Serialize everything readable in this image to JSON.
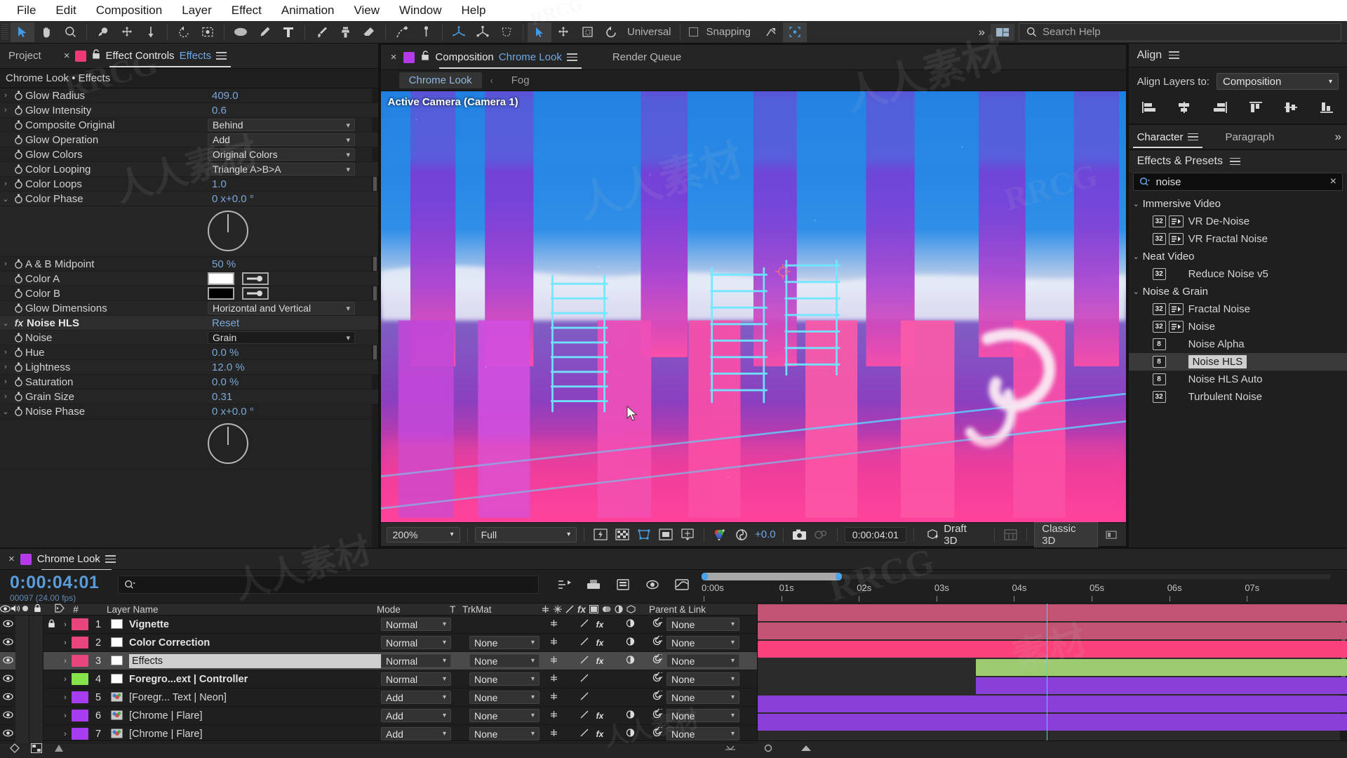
{
  "app": {
    "menu": [
      "File",
      "Edit",
      "Composition",
      "Layer",
      "Effect",
      "Animation",
      "View",
      "Window",
      "Help"
    ],
    "search_help_placeholder": "Search Help",
    "search_icon": "search-icon",
    "universal_label": "Universal",
    "snapping_label": "Snapping"
  },
  "effect_controls": {
    "tab_project": "Project",
    "tab_effect_controls": "Effect Controls",
    "tab_effect_target": "Effects",
    "breadcrumb": "Chrome Look • Effects",
    "rows": [
      {
        "name": "Glow Radius",
        "value": "409.0",
        "kind": "num",
        "twirl": true
      },
      {
        "name": "Glow Intensity",
        "value": "0.6",
        "kind": "num",
        "twirl": true
      },
      {
        "name": "Composite Original",
        "value": "Behind",
        "kind": "drop"
      },
      {
        "name": "Glow Operation",
        "value": "Add",
        "kind": "drop"
      },
      {
        "name": "Glow Colors",
        "value": "Original Colors",
        "kind": "drop"
      },
      {
        "name": "Color Looping",
        "value": "Triangle A>B>A",
        "kind": "drop"
      },
      {
        "name": "Color Loops",
        "value": "1.0",
        "kind": "num",
        "twirl": true
      },
      {
        "name": "Color Phase",
        "value": "0 x+0.0 °",
        "kind": "num",
        "twirl": "open"
      },
      {
        "name": "A & B Midpoint",
        "value": "50 %",
        "kind": "num",
        "twirl": true
      },
      {
        "name": "Color A",
        "value": "#ffffff",
        "kind": "color"
      },
      {
        "name": "Color B",
        "value": "#000000",
        "kind": "color"
      },
      {
        "name": "Glow Dimensions",
        "value": "Horizontal and Vertical",
        "kind": "drop"
      },
      {
        "name": "Noise HLS",
        "value": "Reset",
        "kind": "effect"
      },
      {
        "name": "Noise",
        "value": "Grain",
        "kind": "drop-dark"
      },
      {
        "name": "Hue",
        "value": "0.0 %",
        "kind": "num",
        "twirl": true
      },
      {
        "name": "Lightness",
        "value": "12.0 %",
        "kind": "num",
        "twirl": true
      },
      {
        "name": "Saturation",
        "value": "0.0 %",
        "kind": "num",
        "twirl": true
      },
      {
        "name": "Grain Size",
        "value": "0.31",
        "kind": "num",
        "twirl": true
      },
      {
        "name": "Noise Phase",
        "value": "0 x+0.0 °",
        "kind": "num",
        "twirl": "open"
      }
    ]
  },
  "composition": {
    "panel_label": "Composition",
    "comp_name": "Chrome Look",
    "render_queue": "Render Queue",
    "subtabs": [
      {
        "label": "Chrome Look",
        "active": true
      },
      {
        "label": "Fog",
        "active": false
      }
    ],
    "camera_label": "Active Camera (Camera 1)",
    "bottom": {
      "zoom": "200%",
      "resolution": "Full",
      "exposure": "+0.0",
      "timecode": "0:00:04:01",
      "draft3d": "Draft 3D",
      "renderer": "Classic 3D"
    }
  },
  "align_panel": {
    "title": "Align",
    "align_layers_to_label": "Align Layers to:",
    "align_layers_to_value": "Composition"
  },
  "character_panel": {
    "tab_character": "Character",
    "tab_paragraph": "Paragraph"
  },
  "effects_presets": {
    "title": "Effects & Presets",
    "search_value": "noise",
    "items": [
      {
        "label": "Immersive Video",
        "type": "group"
      },
      {
        "label": "VR De-Noise",
        "type": "effect",
        "bit": "32",
        "anim": true
      },
      {
        "label": "VR Fractal Noise",
        "type": "effect",
        "bit": "32",
        "anim": true
      },
      {
        "label": "Neat Video",
        "type": "group"
      },
      {
        "label": "Reduce Noise v5",
        "type": "effect",
        "bit": "32",
        "anim": false
      },
      {
        "label": "Noise & Grain",
        "type": "group"
      },
      {
        "label": "Fractal Noise",
        "type": "effect",
        "bit": "32",
        "anim": true
      },
      {
        "label": "Noise",
        "type": "effect",
        "bit": "32",
        "anim": true
      },
      {
        "label": "Noise Alpha",
        "type": "effect",
        "bit": "8",
        "anim": false
      },
      {
        "label": "Noise HLS",
        "type": "effect",
        "bit": "8",
        "anim": false,
        "selected": true
      },
      {
        "label": "Noise HLS Auto",
        "type": "effect",
        "bit": "8",
        "anim": false
      },
      {
        "label": "Turbulent Noise",
        "type": "effect",
        "bit": "32",
        "anim": false
      }
    ]
  },
  "timeline": {
    "comp_tab": "Chrome Look",
    "current_time": "0:00:04:01",
    "frame_info": "00097 (24.00 fps)",
    "columns": {
      "hash": "#",
      "layer_name": "Layer Name",
      "mode": "Mode",
      "t": "T",
      "trkmat": "TrkMat",
      "parent_link": "Parent & Link"
    },
    "ruler_labels": [
      "0:00s",
      "01s",
      "02s",
      "03s",
      "04s",
      "05s",
      "06s",
      "07s"
    ],
    "layers": [
      {
        "num": "1",
        "name": "Vignette",
        "mode": "Normal",
        "trkmat": "",
        "color": "#e8447e",
        "locked": true,
        "selected": false,
        "src": "solid",
        "fx": true,
        "bar": "#c35374",
        "bar_start": 0,
        "bar_end": 100
      },
      {
        "num": "2",
        "name": "Color Correction",
        "mode": "Normal",
        "trkmat": "None",
        "color": "#e8447e",
        "locked": false,
        "selected": false,
        "src": "solid",
        "fx": true,
        "bar": "#c35374",
        "bar_start": 0,
        "bar_end": 100
      },
      {
        "num": "3",
        "name": "Effects",
        "mode": "Normal",
        "trkmat": "None",
        "color": "#e8447e",
        "locked": false,
        "selected": true,
        "src": "solid",
        "fx": true,
        "bar": "#fb417c",
        "bar_start": 0,
        "bar_end": 100
      },
      {
        "num": "4",
        "name": "Foregro...ext | Controller",
        "mode": "Normal",
        "trkmat": "None",
        "color": "#86e34a",
        "locked": false,
        "selected": false,
        "src": "solid",
        "fx": false,
        "bar": "#9dcc70",
        "bar_start": 37,
        "bar_end": 100
      },
      {
        "num": "5",
        "name": "[Foregr... Text | Neon]",
        "mode": "Add",
        "trkmat": "None",
        "color": "#a63df0",
        "locked": false,
        "selected": false,
        "src": "comp",
        "fx": false,
        "bar": "#8a3fd8",
        "bar_start": 37,
        "bar_end": 100
      },
      {
        "num": "6",
        "name": "[Chrome | Flare]",
        "mode": "Add",
        "trkmat": "None",
        "color": "#a63df0",
        "locked": false,
        "selected": false,
        "src": "comp",
        "fx": true,
        "bar": "#8a3fd8",
        "bar_start": 0,
        "bar_end": 100
      },
      {
        "num": "7",
        "name": "[Chrome | Flare]",
        "mode": "Add",
        "trkmat": "None",
        "color": "#a63df0",
        "locked": false,
        "selected": false,
        "src": "comp",
        "fx": true,
        "bar": "#8a3fd8",
        "bar_start": 0,
        "bar_end": 100
      }
    ]
  },
  "watermarks": [
    "RRCG",
    "人人素材"
  ],
  "colors": {
    "accent_blue": "#5a9bd8",
    "panel_bg": "#1f1f1f",
    "selection": "#cfcfcf"
  }
}
